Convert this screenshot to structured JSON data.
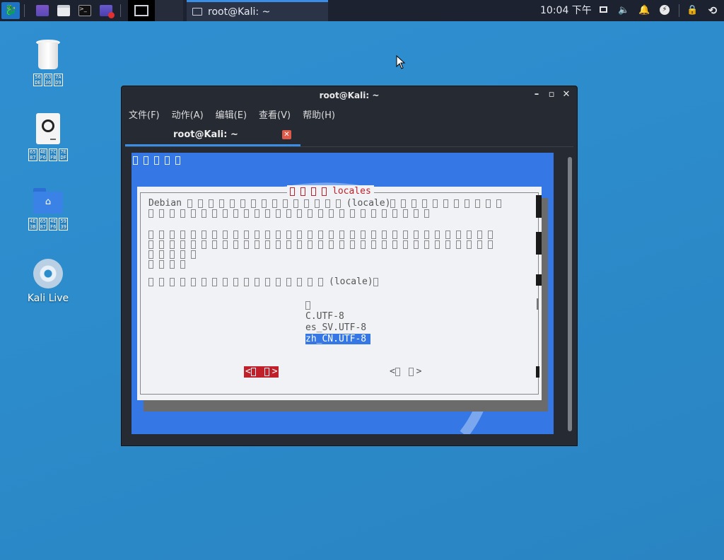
{
  "panel": {
    "clock": "10:04 下午",
    "window_task": "root@Kali: ~"
  },
  "desktop": {
    "icons": [
      {
        "label_hex": [
          [
            "56",
            "DE"
          ],
          [
            "63",
            "36"
          ],
          [
            "7A",
            "D9"
          ]
        ]
      },
      {
        "label_hex": [
          [
            "65",
            "87"
          ],
          [
            "4E",
            "F6"
          ],
          [
            "7C",
            "FB"
          ],
          [
            "7E",
            "DF"
          ]
        ]
      },
      {
        "label_hex": [
          [
            "4E",
            "3B"
          ],
          [
            "65",
            "87"
          ],
          [
            "4E",
            "F6"
          ],
          [
            "59",
            "39"
          ]
        ]
      },
      {
        "label": "Kali Live"
      }
    ]
  },
  "terminal": {
    "window_title": "root@Kali: ~",
    "menus": [
      "文件(F)",
      "动作(A)",
      "编辑(E)",
      "查看(V)",
      "帮助(H)"
    ],
    "tab_title": "root@Kali: ~",
    "dialog": {
      "title": "locales",
      "line1_prefix": "Debian",
      "line1_mid": "(locale)",
      "locale_prompt_word": "(locale)",
      "options": [
        "C.UTF-8",
        "es_SV.UTF-8",
        "zh_CN.UTF-8"
      ],
      "selected_option": "zh_CN.UTF-8",
      "ok_left": "<",
      "ok_right": ">",
      "cancel_left": "<",
      "cancel_right": ">"
    }
  },
  "colors": {
    "desktop_bg": "#2c8ccc",
    "panel_bg": "#1c2230",
    "terminal_bg": "#3578e5",
    "dialog_bg": "#f0f2f5",
    "accent_red": "#c0202a",
    "tab_accent": "#3a8ee6"
  }
}
